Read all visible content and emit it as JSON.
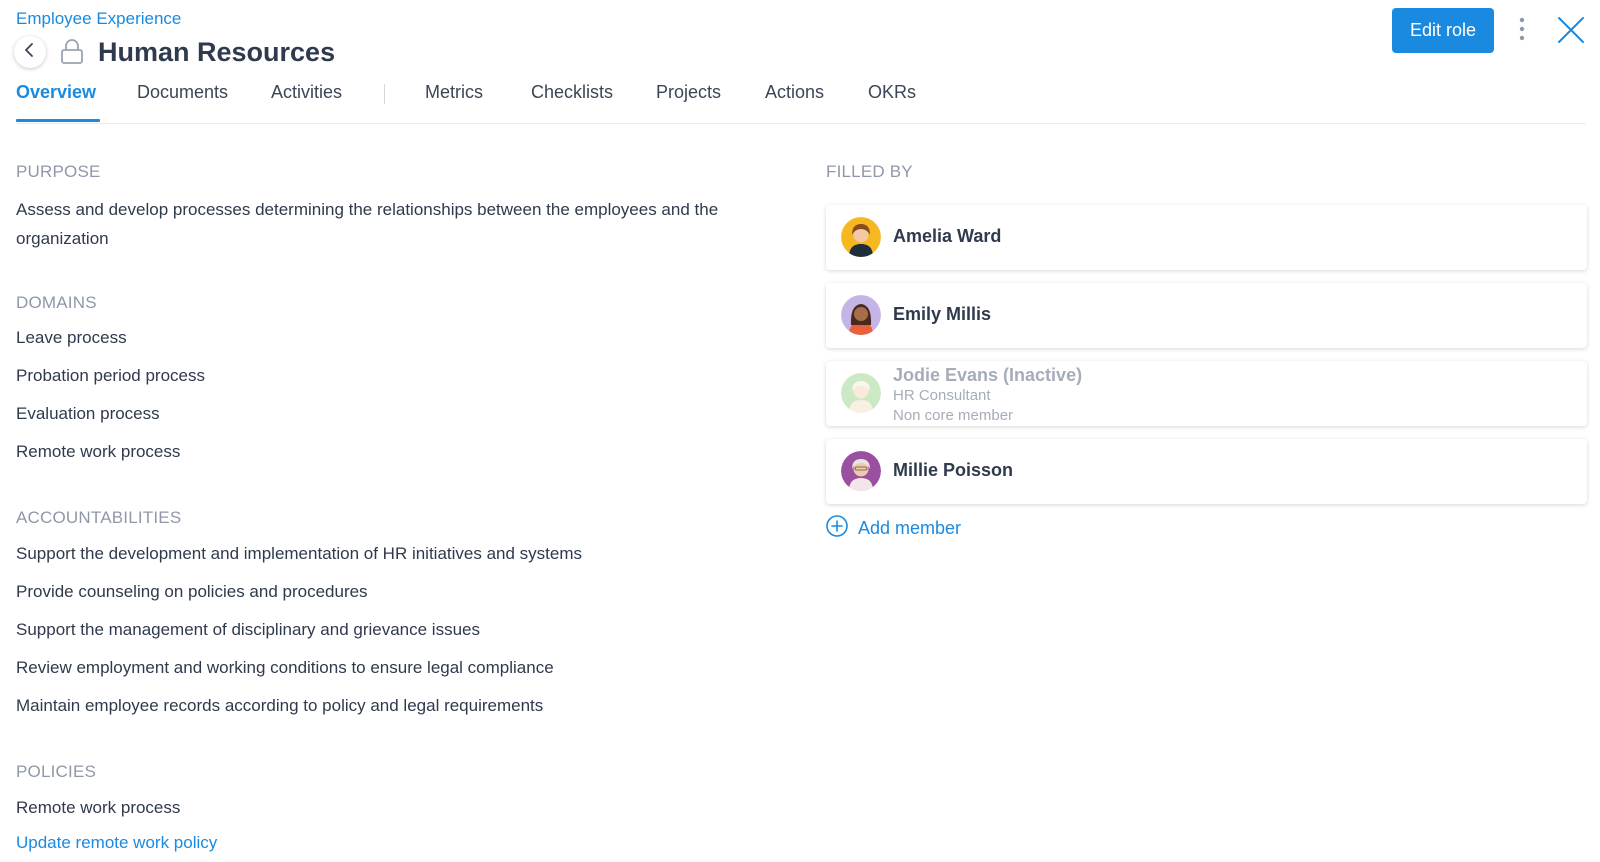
{
  "header": {
    "breadcrumb": "Employee Experience",
    "title": "Human Resources",
    "edit_label": "Edit role"
  },
  "tabs": [
    {
      "label": "Overview",
      "active": true
    },
    {
      "label": "Documents"
    },
    {
      "label": "Activities"
    },
    {
      "label": "Metrics"
    },
    {
      "label": "Checklists"
    },
    {
      "label": "Projects"
    },
    {
      "label": "Actions"
    },
    {
      "label": "OKRs"
    }
  ],
  "purpose": {
    "label": "PURPOSE",
    "text": "Assess and develop processes determining the relationships between the employees and the organization"
  },
  "domains": {
    "label": "DOMAINS",
    "items": [
      "Leave process",
      "Probation period process",
      "Evaluation process",
      "Remote work process"
    ]
  },
  "accountabilities": {
    "label": "ACCOUNTABILITIES",
    "items": [
      "Support the development and implementation of HR initiatives and systems",
      "Provide counseling on policies and procedures",
      "Support the management of disciplinary and grievance issues",
      "Review employment and working conditions to ensure legal compliance",
      "Maintain employee records according to policy and legal requirements"
    ]
  },
  "policies": {
    "label": "POLICIES",
    "items": [
      "Remote work process"
    ],
    "link": "Update remote work policy"
  },
  "filled_by": {
    "label": "FILLED BY",
    "members": [
      {
        "name": "Amelia Ward"
      },
      {
        "name": "Emily Millis"
      },
      {
        "name": "Jodie Evans (Inactive)",
        "role": "HR Consultant",
        "membership": "Non core member",
        "inactive": true
      },
      {
        "name": "Millie Poisson"
      }
    ],
    "add_label": "Add member"
  },
  "colors": {
    "accent": "#1a8ae0",
    "text": "#2f3a4c",
    "muted": "#8f98a8"
  }
}
